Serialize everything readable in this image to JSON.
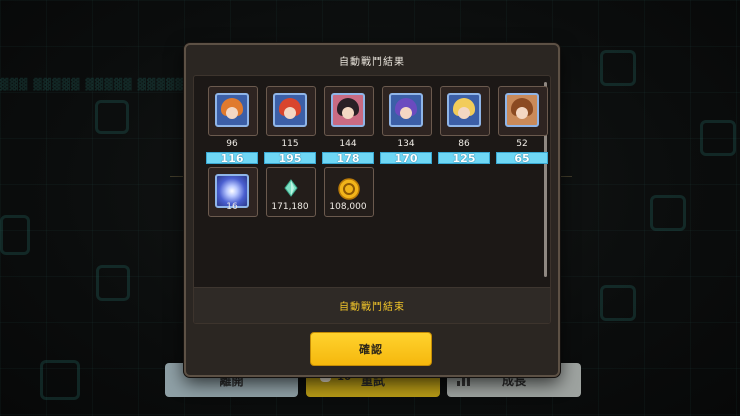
{
  "colors": {
    "accent_yellow": "#f5b80d",
    "level_bar_cyan": "#6fd7f5",
    "status_text_yellow": "#f4c72a",
    "modal_bg": "#2b2622"
  },
  "modal": {
    "title": "自動戰鬥結果",
    "status": "自動戰鬥結束",
    "confirm_label": "確認"
  },
  "heroes": [
    {
      "icon": "hero-portrait-orange-hair-icon",
      "count": "96",
      "level": "116"
    },
    {
      "icon": "hero-portrait-red-hair-icon",
      "count": "115",
      "level": "195"
    },
    {
      "icon": "hero-portrait-dark-hair-icon",
      "count": "144",
      "level": "178"
    },
    {
      "icon": "hero-portrait-purple-hair-icon",
      "count": "134",
      "level": "170"
    },
    {
      "icon": "hero-portrait-blonde-hair-icon",
      "count": "86",
      "level": "125"
    },
    {
      "icon": "hero-portrait-brown-hair-icon",
      "count": "52",
      "level": "65"
    }
  ],
  "items": [
    {
      "icon": "sparkle-crystal-icon",
      "count": "16"
    },
    {
      "icon": "green-gem-icon",
      "count": "171,180"
    },
    {
      "icon": "gold-coin-icon",
      "count": "108,000"
    }
  ],
  "bottom_bar": {
    "leave_label": "離開",
    "retry_label": "重試",
    "retry_cost": "-10",
    "grow_label": "成長"
  }
}
